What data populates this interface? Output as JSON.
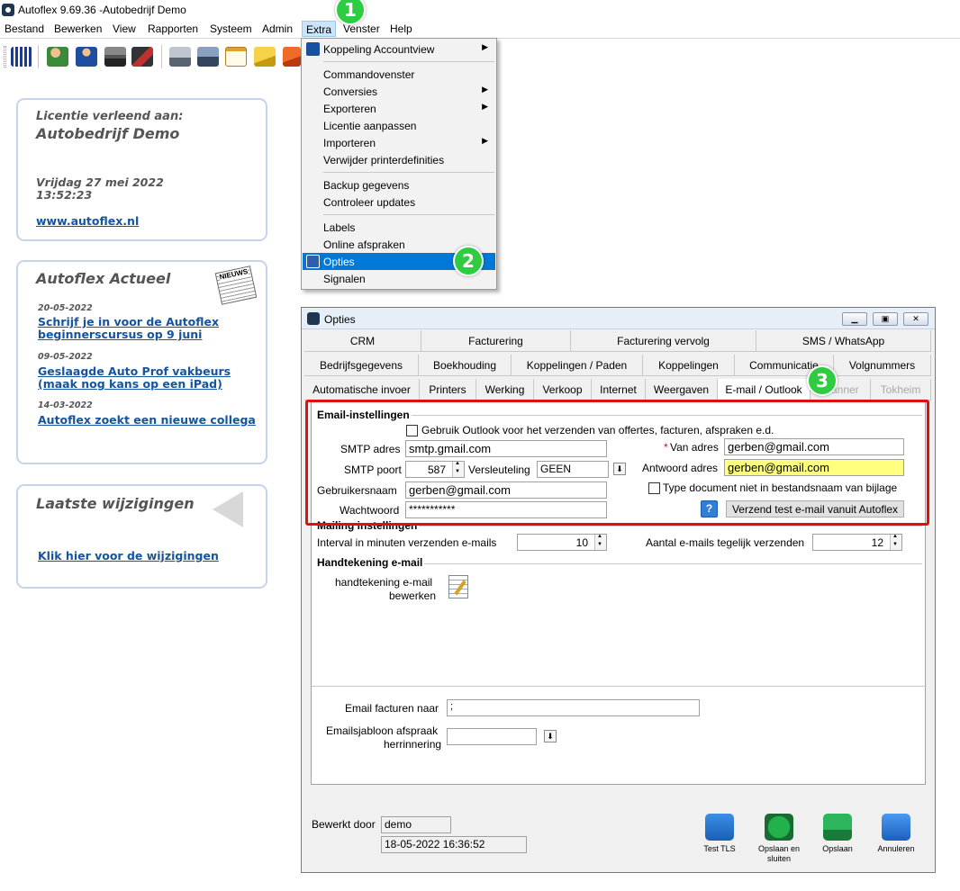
{
  "app": {
    "title": "Autoflex 9.69.36 -Autobedrijf Demo"
  },
  "menubar": {
    "items": [
      {
        "label": "Bestand"
      },
      {
        "label": "Bewerken"
      },
      {
        "label": "View"
      },
      {
        "label": "Rapporten"
      },
      {
        "label": "Systeem"
      },
      {
        "label": "Admin"
      },
      {
        "label": "Extra"
      },
      {
        "label": "Venster"
      },
      {
        "label": "Help"
      }
    ]
  },
  "extra_menu": {
    "items": {
      "koppeling_accountview": "Koppeling Accountview",
      "commandovenster": "Commandovenster",
      "conversies": "Conversies",
      "exporteren": "Exporteren",
      "licentie_aanpassen": "Licentie aanpassen",
      "importeren": "Importeren",
      "verwijder_printerdefinities": "Verwijder printerdefinities",
      "backup_gegevens": "Backup gegevens",
      "controleer_updates": "Controleer updates",
      "labels": "Labels",
      "online_afspraken": "Online afspraken",
      "opties": "Opties",
      "signalen": "Signalen"
    }
  },
  "badges": {
    "one": "1",
    "two": "2",
    "three": "3"
  },
  "license_panel": {
    "line1": "Licentie verleend aan:",
    "company": "Autobedrijf Demo",
    "date": "Vrijdag 27 mei 2022",
    "time": "13:52:23",
    "link": "www.autoflex.nl"
  },
  "news_panel": {
    "title": "Autoflex Actueel",
    "icon_text": "NIEUWS",
    "items": [
      {
        "date": "20-05-2022",
        "line1": "Schrijf je in voor de Autoflex",
        "line2": "beginnerscursus op 9 juni"
      },
      {
        "date": "09-05-2022",
        "line1": "Geslaagde Auto Prof vakbeurs",
        "line2": "(maak nog kans op een iPad)"
      },
      {
        "date": "14-03-2022",
        "line1": "Autoflex zoekt een nieuwe collega",
        "line2": ""
      }
    ]
  },
  "changes_panel": {
    "title": "Laatste wijzigingen",
    "link": "Klik hier voor de wijzigingen"
  },
  "dialog": {
    "title": "Opties",
    "tabs_row1": [
      "CRM",
      "Facturering",
      "Facturering vervolg",
      "SMS / WhatsApp"
    ],
    "tabs_row2": [
      "Bedrijfsgegevens",
      "Boekhouding",
      "Koppelingen / Paden",
      "Koppelingen",
      "Communicatie",
      "Volgnummers"
    ],
    "tabs_row3": [
      "Automatische invoer",
      "Printers",
      "Werking",
      "Verkoop",
      "Internet",
      "Weergaven",
      "E-mail / Outlook",
      "Planner",
      "Tokheim"
    ],
    "email": {
      "group_title": "Email-instellingen",
      "use_outlook_label": "Gebruik Outlook voor het verzenden van offertes, facturen, afspraken e.d.",
      "smtp_label": "SMTP adres",
      "smtp_value": "smtp.gmail.com",
      "port_label": "SMTP poort",
      "port_value": "587",
      "encryption_label": "Versleuteling",
      "encryption_value": "GEEN",
      "username_label": "Gebruikersnaam",
      "username_value": "gerben@gmail.com",
      "password_label": "Wachtwoord",
      "password_value": "***********",
      "from_star": "*",
      "from_label": "Van adres",
      "from_value": "gerben@gmail.com",
      "reply_label": "Antwoord adres",
      "reply_value": "gerben@gmail.com",
      "typedoc_label": "Type document niet in bestandsnaam van bijlage",
      "help_icon": "?",
      "test_button": "Verzend test e-mail vanuit Autoflex"
    },
    "mailing": {
      "group_title": "Mailing instellingen",
      "interval_label": "Interval in minuten verzenden e-mails",
      "interval_value": "10",
      "count_label": "Aantal e-mails tegelijk verzenden",
      "count_value": "12"
    },
    "signature": {
      "group_title": "Handtekening e-mail",
      "edit_label1": "handtekening e-mail",
      "edit_label2": "bewerken"
    },
    "invoices_label": "Email facturen naar",
    "invoices_value": ";",
    "template_label1": "Emailsjabloon afspraak",
    "template_label2": "herrinnering",
    "template_value": "",
    "edited_by_label": "Bewerkt door",
    "edited_by_value": "demo",
    "edited_at_value": "18-05-2022 16:36:52",
    "buttons": {
      "test_tls": "Test TLS",
      "save_close1": "Opslaan en",
      "save_close2": "sluiten",
      "save": "Opslaan",
      "cancel": "Annuleren"
    }
  }
}
